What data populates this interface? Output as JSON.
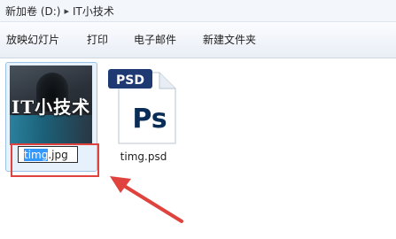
{
  "address_bar": {
    "crumbs": [
      "新加卷 (D:)",
      "IT小技术"
    ],
    "separator": "▸"
  },
  "toolbar": {
    "buttons": [
      "放映幻灯片",
      "打印",
      "电子邮件",
      "新建文件夹"
    ]
  },
  "files": [
    {
      "name": "timg.jpg",
      "rename_selected": "timg",
      "rename_rest": ".jpg",
      "thumbnail_text": "IT小技术",
      "selected": true,
      "renaming": true
    },
    {
      "name": "timg.psd",
      "icon": "photoshop-file-icon",
      "icon_tab_text": "PSD",
      "icon_text": "Ps"
    }
  ],
  "colors": {
    "highlight": "#3399ff",
    "annotation_red": "#e0423e",
    "ps_blue": "#001d3d"
  }
}
